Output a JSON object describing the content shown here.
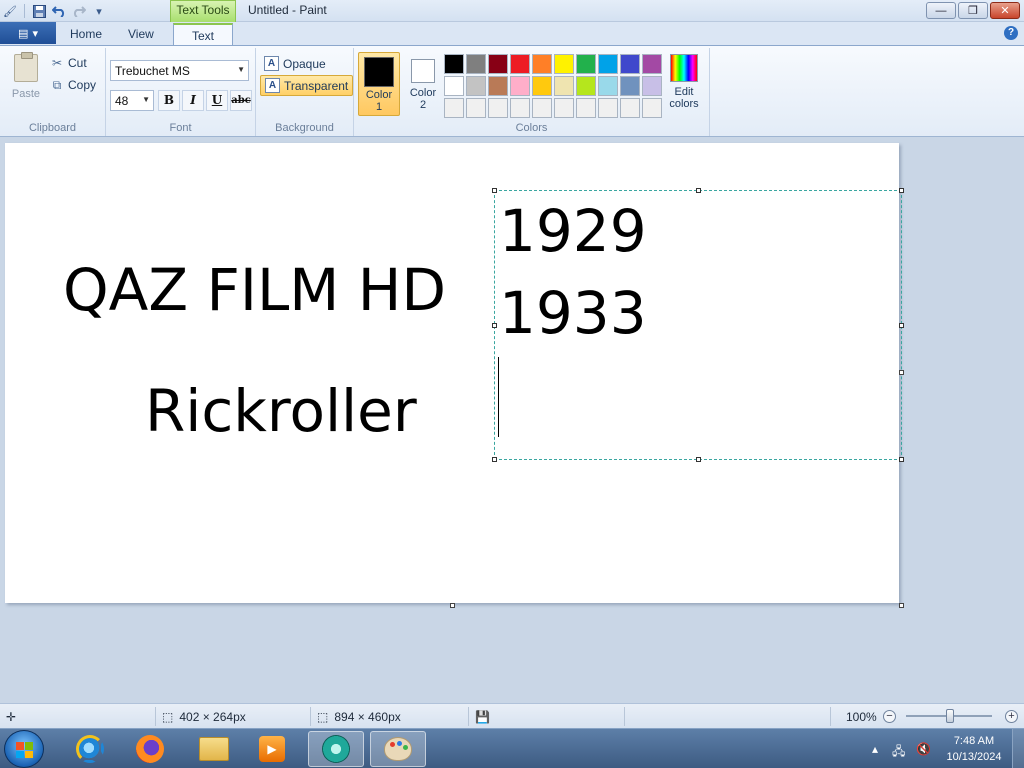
{
  "window": {
    "title": "Untitled - Paint",
    "contextual_tab": "Text Tools",
    "controls": {
      "minimize": "—",
      "maximize": "❐",
      "close": "✕"
    }
  },
  "tabs": [
    {
      "label": "Home"
    },
    {
      "label": "View"
    },
    {
      "label": "Text",
      "active": true
    }
  ],
  "ribbon": {
    "clipboard": {
      "label": "Clipboard",
      "paste": "Paste",
      "cut": "Cut",
      "copy": "Copy"
    },
    "font": {
      "label": "Font",
      "family": "Trebuchet MS",
      "size": "48",
      "bold": "B",
      "italic": "I",
      "underline": "U",
      "strikethrough": "abc"
    },
    "background": {
      "label": "Background",
      "opaque": "Opaque",
      "transparent": "Transparent",
      "selected": "Transparent"
    },
    "colors": {
      "label": "Colors",
      "color1_line1": "Color",
      "color1_line2": "1",
      "color2_line1": "Color",
      "color2_line2": "2",
      "edit_line1": "Edit",
      "edit_line2": "colors",
      "color1_value": "#000000",
      "color2_value": "#ffffff",
      "palette": [
        "#000000",
        "#7f7f7f",
        "#880015",
        "#ed1c24",
        "#ff7f27",
        "#fff200",
        "#22b14c",
        "#00a2e8",
        "#3f48cc",
        "#a349a4",
        "#ffffff",
        "#c3c3c3",
        "#b97a57",
        "#ffaec9",
        "#ffc90e",
        "#efe4b0",
        "#b5e61d",
        "#99d9ea",
        "#7092be",
        "#c8bfe7",
        "#f0f0f0",
        "#f0f0f0",
        "#f0f0f0",
        "#f0f0f0",
        "#f0f0f0",
        "#f0f0f0",
        "#f0f0f0",
        "#f0f0f0",
        "#f0f0f0",
        "#f0f0f0"
      ]
    }
  },
  "canvas": {
    "text_line_1": "QAZ FILM HD",
    "text_line_2": "Rickroller",
    "textbox_lines": [
      "1929",
      "1933"
    ]
  },
  "statusbar": {
    "selection_size": "402 × 264px",
    "canvas_size": "894 × 460px",
    "zoom": "100%"
  },
  "taskbar": {
    "time": "7:48 AM",
    "date": "10/13/2024"
  }
}
